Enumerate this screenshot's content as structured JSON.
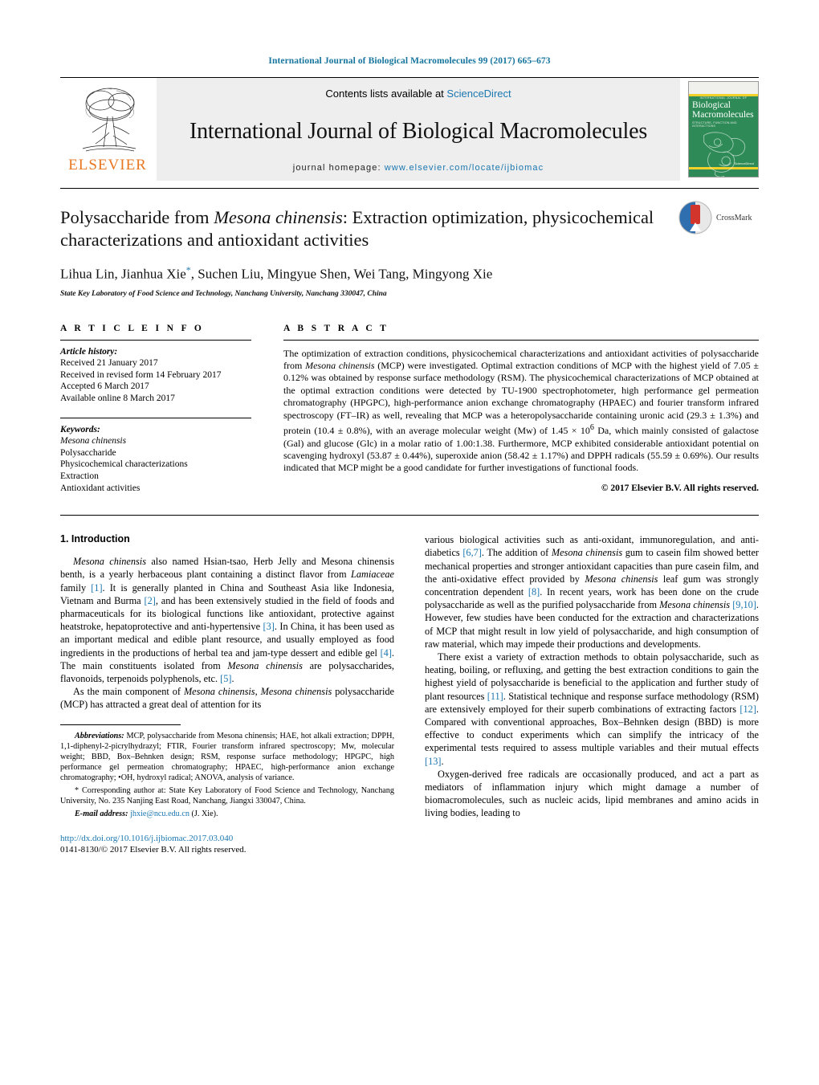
{
  "running_head": "International Journal of Biological Macromolecules 99 (2017) 665–673",
  "masthead": {
    "publisher_name": "ELSEVIER",
    "contents_prefix": "Contents lists available at",
    "contents_link": "ScienceDirect",
    "journal_title": "International Journal of Biological Macromolecules",
    "homepage_label": "journal homepage:",
    "homepage_url": "www.elsevier.com/locate/ijbiomac",
    "cover": {
      "eyebrow": "INTERNATIONAL JOURNAL OF",
      "title_line1": "Biological",
      "title_line2": "Macromolecules",
      "subtitle": "STRUCTURE, FUNCTION AND INTERACTIONS",
      "footer": "ScienceDirect"
    },
    "accent_color": "#1b77b0",
    "elsevier_color": "#e87722"
  },
  "article": {
    "title_part1": "Polysaccharide from ",
    "title_italic": "Mesona chinensis",
    "title_part2": ": Extraction optimization, physicochemical characterizations and antioxidant activities",
    "authors": "Lihua Lin, Jianhua Xie",
    "authors_star": "*",
    "authors_rest": ", Suchen Liu, Mingyue Shen, Wei Tang, Mingyong Xie",
    "affiliation": "State Key Laboratory of Food Science and Technology, Nanchang University, Nanchang 330047, China",
    "crossmark_label": "CrossMark"
  },
  "article_info": {
    "heading": "A R T I C L E   I N F O",
    "history_label": "Article history:",
    "history": [
      "Received 21 January 2017",
      "Received in revised form 14 February 2017",
      "Accepted 6 March 2017",
      "Available online 8 March 2017"
    ],
    "keywords_label": "Keywords:",
    "keywords_italic": "Mesona chinensis",
    "keywords": [
      "Polysaccharide",
      "Physicochemical characterizations",
      "Extraction",
      "Antioxidant activities"
    ]
  },
  "abstract": {
    "heading": "A B S T R A C T",
    "p1_a": "The optimization of extraction conditions, physicochemical characterizations and antioxidant activities of polysaccharide from ",
    "p1_em1": "Mesona chinensis",
    "p1_b": " (MCP) were investigated. Optimal extraction conditions of MCP with the highest yield of 7.05 ± 0.12% was obtained by response surface methodology (RSM). The physicochemical characterizations of MCP obtained at the optimal extraction conditions were detected by TU-1900 spectrophotometer, high performance gel permeation chromatography (HPGPC), high-performance anion exchange chromatography (HPAEC) and fourier transform infrared spectroscopy (FT–IR) as well, revealing that MCP was a heteropolysaccharide containing uronic acid (29.3 ± 1.3%) and protein (10.4 ± 0.8%), with an average molecular weight (Mw) of 1.45 × 10",
    "p1_sup": "6",
    "p1_c": " Da, which mainly consisted of galactose (Gal) and glucose (Glc) in a molar ratio of 1.00:1.38. Furthermore, MCP exhibited considerable antioxidant potential on scavenging hydroxyl (53.87 ± 0.44%), superoxide anion (58.42 ± 1.17%) and DPPH radicals (55.59 ± 0.69%). Our results indicated that MCP might be a good candidate for further investigations of functional foods.",
    "copyright": "© 2017 Elsevier B.V. All rights reserved."
  },
  "introduction": {
    "heading": "1.  Introduction",
    "left": {
      "p1_em1": "Mesona chinensis",
      "p1_a": " also named Hsian-tsao, Herb Jelly and Mesona chinensis benth, is a yearly herbaceous plant containing a distinct flavor from ",
      "p1_em2": "Lamiaceae",
      "p1_b": " family ",
      "p1_ref1": "[1]",
      "p1_c": ". It is generally planted in China and Southeast Asia like Indonesia, Vietnam and Burma ",
      "p1_ref2": "[2]",
      "p1_d": ", and has been extensively studied in the field of foods and pharmaceuticals for its biological functions like antioxidant, protective against heatstroke, hepatoprotective and anti-hypertensive ",
      "p1_ref3": "[3]",
      "p1_e": ". In China, it has been used as an important medical and edible plant resource, and usually employed as food ingredients in the productions of herbal tea and jam-type dessert and edible gel ",
      "p1_ref4": "[4]",
      "p1_f": ". The main constituents isolated from ",
      "p1_em3": "Mesona chinensis",
      "p1_g": " are polysaccharides, flavonoids, terpenoids polyphenols, etc. ",
      "p1_ref5": "[5]",
      "p1_h": ".",
      "p2_a": "As the main component of ",
      "p2_em1": "Mesona chinensis",
      "p2_b": ", ",
      "p2_em2": "Mesona chinensis",
      "p2_c": " polysaccharide (MCP) has attracted a great deal of attention for its"
    },
    "right": {
      "p1_a": "various biological activities such as anti-oxidant, immunoregulation, and anti-diabetics ",
      "p1_ref1": "[6,7]",
      "p1_b": ". The addition of ",
      "p1_em1": "Mesona chinensis",
      "p1_c": " gum to casein film showed better mechanical properties and stronger antioxidant capacities than pure casein film, and the anti-oxidative effect provided by ",
      "p1_em2": "Mesona chinensis",
      "p1_d": " leaf gum was strongly concentration dependent ",
      "p1_ref2": "[8]",
      "p1_e": ". In recent years, work has been done on the crude polysaccharide as well as the purified polysaccharide from ",
      "p1_em3": "Mesona chinensis",
      "p1_f": " ",
      "p1_ref3": "[9,10]",
      "p1_g": ". However, few studies have been conducted for the extraction and characterizations of MCP that might result in low yield of polysaccharide, and high consumption of raw material, which may impede their productions and developments.",
      "p2_a": "There exist a variety of extraction methods to obtain polysaccharide, such as heating, boiling, or refluxing, and getting the best extraction conditions to gain the highest yield of polysaccharide is beneficial to the application and further study of plant resources ",
      "p2_ref1": "[11]",
      "p2_b": ". Statistical technique and response surface methodology (RSM) are extensively employed for their superb combinations of extracting factors ",
      "p2_ref2": "[12]",
      "p2_c": ". Compared with conventional approaches, Box–Behnken design (BBD) is more effective to conduct experiments which can simplify the intricacy of the experimental tests required to assess multiple variables and their mutual effects ",
      "p2_ref3": "[13]",
      "p2_d": ".",
      "p3": "Oxygen-derived free radicals are occasionally produced, and act a part as mediators of inflammation injury which might damage a number of biomacromolecules, such as nucleic acids, lipid membranes and amino acids in living bodies, leading to"
    }
  },
  "footnotes": {
    "abbrev_label": "Abbreviations:",
    "abbrev_a": "  MCP, polysaccharide from Mesona chinensis; HAE, hot alkali extraction; DPPH, 1,1-diphenyl-2-picrylhydrazyl; FTIR, Fourier transform infrared spectroscopy; Mw, molecular weight; BBD, Box–Behnken design; RSM, response surface methodology; HPGPC, high performance gel permeation chromatography; HPAEC, high-performance anion exchange chromatography; •OH, hydroxyl radical; ANOVA, analysis of variance.",
    "corresponding_star": "*",
    "corresponding": " Corresponding author at: State Key Laboratory of Food Science and Technology, Nanchang University, No. 235 Nanjing East Road, Nanchang, Jiangxi 330047, China.",
    "email_label": "E-mail address:",
    "email": "jhxie@ncu.edu.cn",
    "email_suffix": " (J. Xie)."
  },
  "footer": {
    "doi": "http://dx.doi.org/10.1016/j.ijbiomac.2017.03.040",
    "issn_line": "0141-8130/© 2017 Elsevier B.V. All rights reserved."
  }
}
